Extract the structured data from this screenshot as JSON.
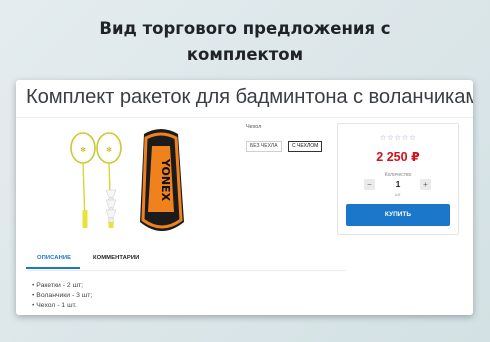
{
  "headline": {
    "line1": "Вид торгового предложения с",
    "line2": "комплектом"
  },
  "product": {
    "title": "Комплект ракеток для бадминтона с воланчиками",
    "image_alt": "racket-set-with-bag-image"
  },
  "options": {
    "label": "Чехол",
    "chips": [
      {
        "label": "БЕЗ ЧЕХЛА",
        "selected": false
      },
      {
        "label": "С ЧЕХЛОМ",
        "selected": true
      }
    ]
  },
  "buy_panel": {
    "rating": "☆☆☆☆☆",
    "price": "2 250 ₽",
    "quantity_label": "Количество",
    "quantity_value": "1",
    "quantity_unit": "шт",
    "minus": "−",
    "plus": "+",
    "buy_label": "КУПИТЬ"
  },
  "tabs": [
    {
      "label": "ОПИСАНИЕ",
      "active": true
    },
    {
      "label": "КОММЕНТАРИИ",
      "active": false
    }
  ],
  "description": [
    "Ракетки - 2 шт;",
    "Воланчики - 3 шт;",
    "Чехол - 1 шт."
  ],
  "colors": {
    "accent": "#1a77c9",
    "price": "#d0121c",
    "bag_orange": "#f0821e",
    "racket_yellow": "#e8e23a"
  }
}
